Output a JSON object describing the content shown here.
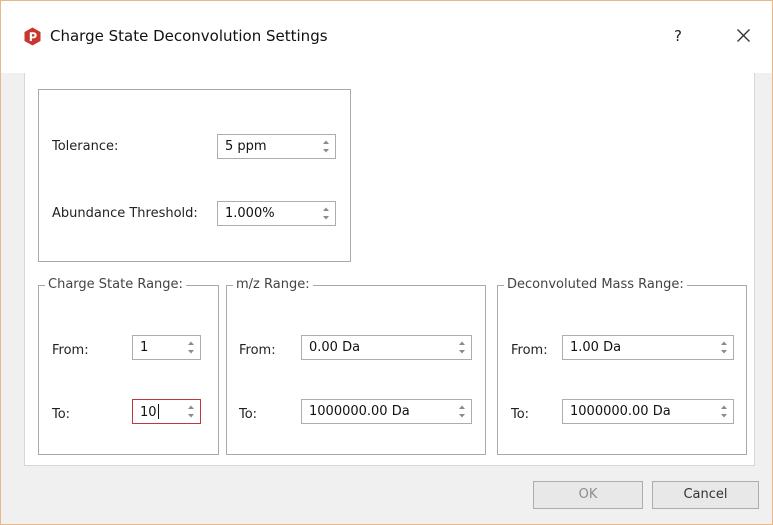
{
  "window": {
    "title": "Charge State Deconvolution Settings",
    "help_label": "?"
  },
  "general": {
    "tolerance_label": "Tolerance:",
    "tolerance_value": "5 ppm",
    "abundance_label": "Abundance Threshold:",
    "abundance_value": "1.000%"
  },
  "charge_state_range": {
    "title": "Charge State Range:",
    "from_label": "From:",
    "from_value": "1",
    "to_label": "To:",
    "to_value": "10"
  },
  "mz_range": {
    "title": "m/z Range:",
    "from_label": "From:",
    "from_value": "0.00 Da",
    "to_label": "To:",
    "to_value": "1000000.00 Da"
  },
  "deconvoluted_mass_range": {
    "title": "Deconvoluted Mass Range:",
    "from_label": "From:",
    "from_value": "1.00 Da",
    "to_label": "To:",
    "to_value": "1000000.00 Da"
  },
  "footer": {
    "ok_label": "OK",
    "cancel_label": "Cancel"
  },
  "colors": {
    "app_icon": "#c8372d",
    "focus_border": "#c0383e",
    "window_border": "#e7b98a"
  },
  "icons": {
    "app": "app-logo-icon",
    "close": "close-icon",
    "spin_arrows": "spin-arrows-icon"
  }
}
